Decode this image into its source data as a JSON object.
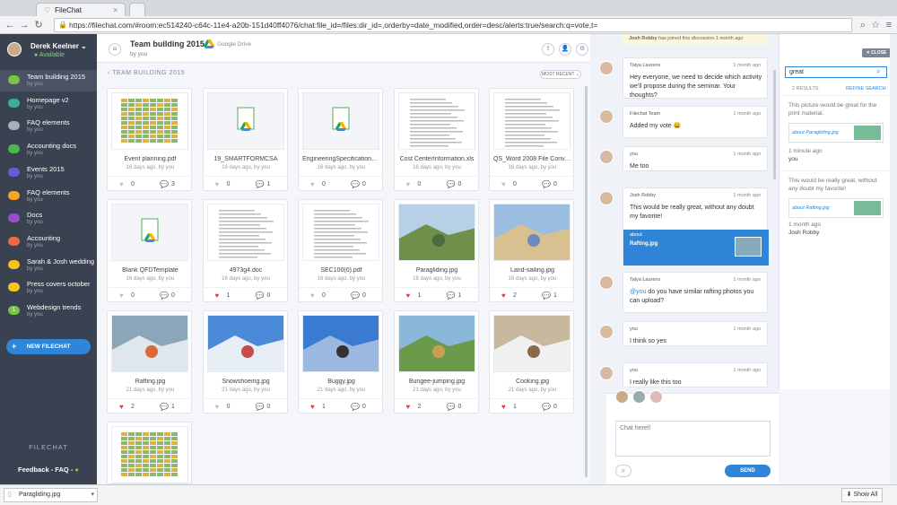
{
  "browser": {
    "tab_title": "FileChat",
    "url": "https://filechat.com/#room:ec514240-c64c-11e4-a20b-151d40ff4076/chat:file_id=/files:dir_id=,orderby=date_modified,order=desc/alerts:true/search:q=vote,t="
  },
  "user": {
    "name": "Derek Keelner",
    "status": "Available"
  },
  "sidebar": {
    "items": [
      {
        "name": "Team building 2015",
        "by": "by you",
        "color": "#7cc243",
        "active": true
      },
      {
        "name": "Homepage v2",
        "by": "by you",
        "color": "#3ab08f"
      },
      {
        "name": "FAQ elements",
        "by": "by you",
        "color": "#a9aeb8"
      },
      {
        "name": "Accounting docs",
        "by": "by you",
        "color": "#4db84a"
      },
      {
        "name": "Events 2015",
        "by": "by you",
        "color": "#5a63d6"
      },
      {
        "name": "FAQ elements",
        "by": "by you",
        "color": "#f5a623"
      },
      {
        "name": "Docs",
        "by": "by you",
        "color": "#9b4dca"
      },
      {
        "name": "Accounting",
        "by": "by you",
        "color": "#ef6a3a"
      },
      {
        "name": "Sarah & Josh wedding",
        "by": "by you",
        "color": "#f5c518"
      },
      {
        "name": "Press covers october",
        "by": "by you",
        "color": "#f5c518"
      },
      {
        "name": "Webdesign trends",
        "by": "by you",
        "color": "#7cc243",
        "badge": "1"
      }
    ],
    "new_button": "NEW FILECHAT",
    "brand": "FILECHAT",
    "footer": "Feedback - FAQ -"
  },
  "main": {
    "title": "Team building 2015",
    "by": "by you",
    "drive_label": "Google Drive",
    "section": "‹ TEAM BUILDING 2015",
    "sort": "MOST RECENT ⌄",
    "files": [
      {
        "name": "Event planning.pdf",
        "meta": "16 days ago, by you",
        "likes": "0",
        "comments": "3",
        "liked": false,
        "commented": true,
        "kind": "sheet"
      },
      {
        "name": "19_SMARTFORMCSA",
        "meta": "16 days ago, by you",
        "likes": "0",
        "comments": "1",
        "liked": false,
        "commented": true,
        "kind": "drive"
      },
      {
        "name": "EngineeringSpecifications Fi...",
        "meta": "16 days ago, by you",
        "likes": "0",
        "comments": "0",
        "liked": false,
        "commented": false,
        "kind": "drive"
      },
      {
        "name": "Cost CenterInformation.xls",
        "meta": "16 days ago, by you",
        "likes": "0",
        "comments": "0",
        "liked": false,
        "commented": false,
        "kind": "doc"
      },
      {
        "name": "QS_Word 2008 File Convert...",
        "meta": "16 days ago, by you",
        "likes": "0",
        "comments": "0",
        "liked": false,
        "commented": false,
        "kind": "doc"
      },
      {
        "name": "Blank QFDTemplate",
        "meta": "16 days ago, by you",
        "likes": "0",
        "comments": "0",
        "liked": false,
        "commented": false,
        "kind": "drive"
      },
      {
        "name": "4973g4.doc",
        "meta": "16 days ago, by you",
        "likes": "1",
        "comments": "0",
        "liked": true,
        "commented": false,
        "kind": "doc"
      },
      {
        "name": "SEC100(0).pdf",
        "meta": "16 days ago, by you",
        "likes": "0",
        "comments": "0",
        "liked": false,
        "commented": false,
        "kind": "doc"
      },
      {
        "name": "Paragliding.jpg",
        "meta": "16 days ago, by you",
        "likes": "1",
        "comments": "1",
        "liked": true,
        "commented": true,
        "kind": "photo-mountain"
      },
      {
        "name": "Land-sailing.jpg",
        "meta": "16 days ago, by you",
        "likes": "2",
        "comments": "1",
        "liked": true,
        "commented": true,
        "kind": "photo-beach"
      },
      {
        "name": "Rafting.jpg",
        "meta": "21 days ago, by you",
        "likes": "2",
        "comments": "1",
        "liked": true,
        "commented": false,
        "kind": "photo-water"
      },
      {
        "name": "Snowshoeing.jpg",
        "meta": "21 days ago, by you",
        "likes": "0",
        "comments": "0",
        "liked": false,
        "commented": false,
        "kind": "photo-snow"
      },
      {
        "name": "Buggy.jpg",
        "meta": "21 days ago, by you",
        "likes": "1",
        "comments": "0",
        "liked": true,
        "commented": false,
        "kind": "photo-sky"
      },
      {
        "name": "Bungee-jumping.jpg",
        "meta": "21 days ago, by you",
        "likes": "2",
        "comments": "0",
        "liked": true,
        "commented": false,
        "kind": "photo-green"
      },
      {
        "name": "Cooking.jpg",
        "meta": "21 days ago, by you",
        "likes": "1",
        "comments": "0",
        "liked": true,
        "commented": false,
        "kind": "photo-kitchen"
      }
    ]
  },
  "chat": {
    "join_banner_user": "Josh Robby",
    "join_banner_text": "has joined this discussion",
    "join_banner_time": "1 month ago",
    "messages": [
      {
        "user": "Talya Laurens",
        "time": "1 month ago",
        "text": "Hey everyone, we need to decide which activity we'll propose during the seminar. Your thoughts?"
      },
      {
        "user": "Filechat Team",
        "time": "1 month ago",
        "text": "Added my vote 😀"
      },
      {
        "user": "you",
        "time": "1 month ago",
        "text": "Me too"
      },
      {
        "user": "Josh Robby",
        "time": "1 month ago",
        "text": "This would be really great, without any doubt my favorite!",
        "attach_about": "about",
        "attach_name": "Rafting.jpg"
      },
      {
        "user": "Talya Laurens",
        "time": "1 month ago",
        "mention": "@you",
        "text": " do you have similar rafting photos you can upload?"
      },
      {
        "user": "you",
        "time": "1 month ago",
        "text": "I think so yes"
      },
      {
        "user": "you",
        "time": "1 month ago",
        "text": "I really like this too"
      }
    ],
    "input_placeholder": "Chat here!!",
    "send": "SEND"
  },
  "search": {
    "close": "CLOSE",
    "query": "great",
    "count": "2 RESULTS",
    "refine": "REFINE SEARCH",
    "results": [
      {
        "text": "This picture would be great for the print material.",
        "about": "about Paragliding.jpg",
        "time": "1 minute ago",
        "author": "you"
      },
      {
        "text": "This would be really great, without any doubt my favorite!",
        "about": "about Rafting.jpg",
        "time": "1 month ago",
        "author": "Josh Robby"
      }
    ]
  },
  "downloads": {
    "file": "Paragliding.jpg",
    "show_all": "Show All"
  }
}
